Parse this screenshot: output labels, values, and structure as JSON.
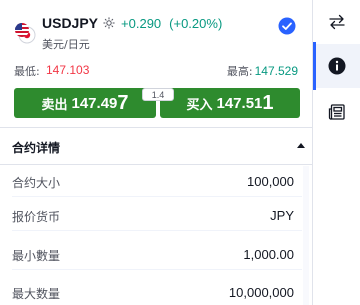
{
  "header": {
    "symbol": "USDJPY",
    "change": "+0.290",
    "change_pct": "(+0.20%)",
    "description": "美元/日元",
    "icons": {
      "flag": "us-jp-flag-icon",
      "session": "sun-icon",
      "verified": "check-icon"
    }
  },
  "range": {
    "low_label": "最低:",
    "low_value": "147.103",
    "high_label": "最高:",
    "high_value": "147.529"
  },
  "trade": {
    "sell_label": "卖出",
    "sell_price_main": "147.49",
    "sell_price_last": "7",
    "buy_label": "买入",
    "buy_price_main": "147.51",
    "buy_price_last": "1",
    "spread": "1.4"
  },
  "details": {
    "title": "合约详情",
    "rows": [
      {
        "label": "合约大小",
        "value": "100,000"
      },
      {
        "label": "报价货币",
        "value": "JPY"
      },
      {
        "label": "最小數量",
        "value": "1,000.00"
      },
      {
        "label": "最大数量",
        "value": "10,000,000"
      }
    ]
  },
  "right_rail": {
    "items": [
      "swap-arrows-icon",
      "info-icon",
      "news-icon"
    ]
  },
  "colors": {
    "up": "#089981",
    "down": "#f23645",
    "button": "#2e8b2e",
    "accent": "#2962ff"
  }
}
